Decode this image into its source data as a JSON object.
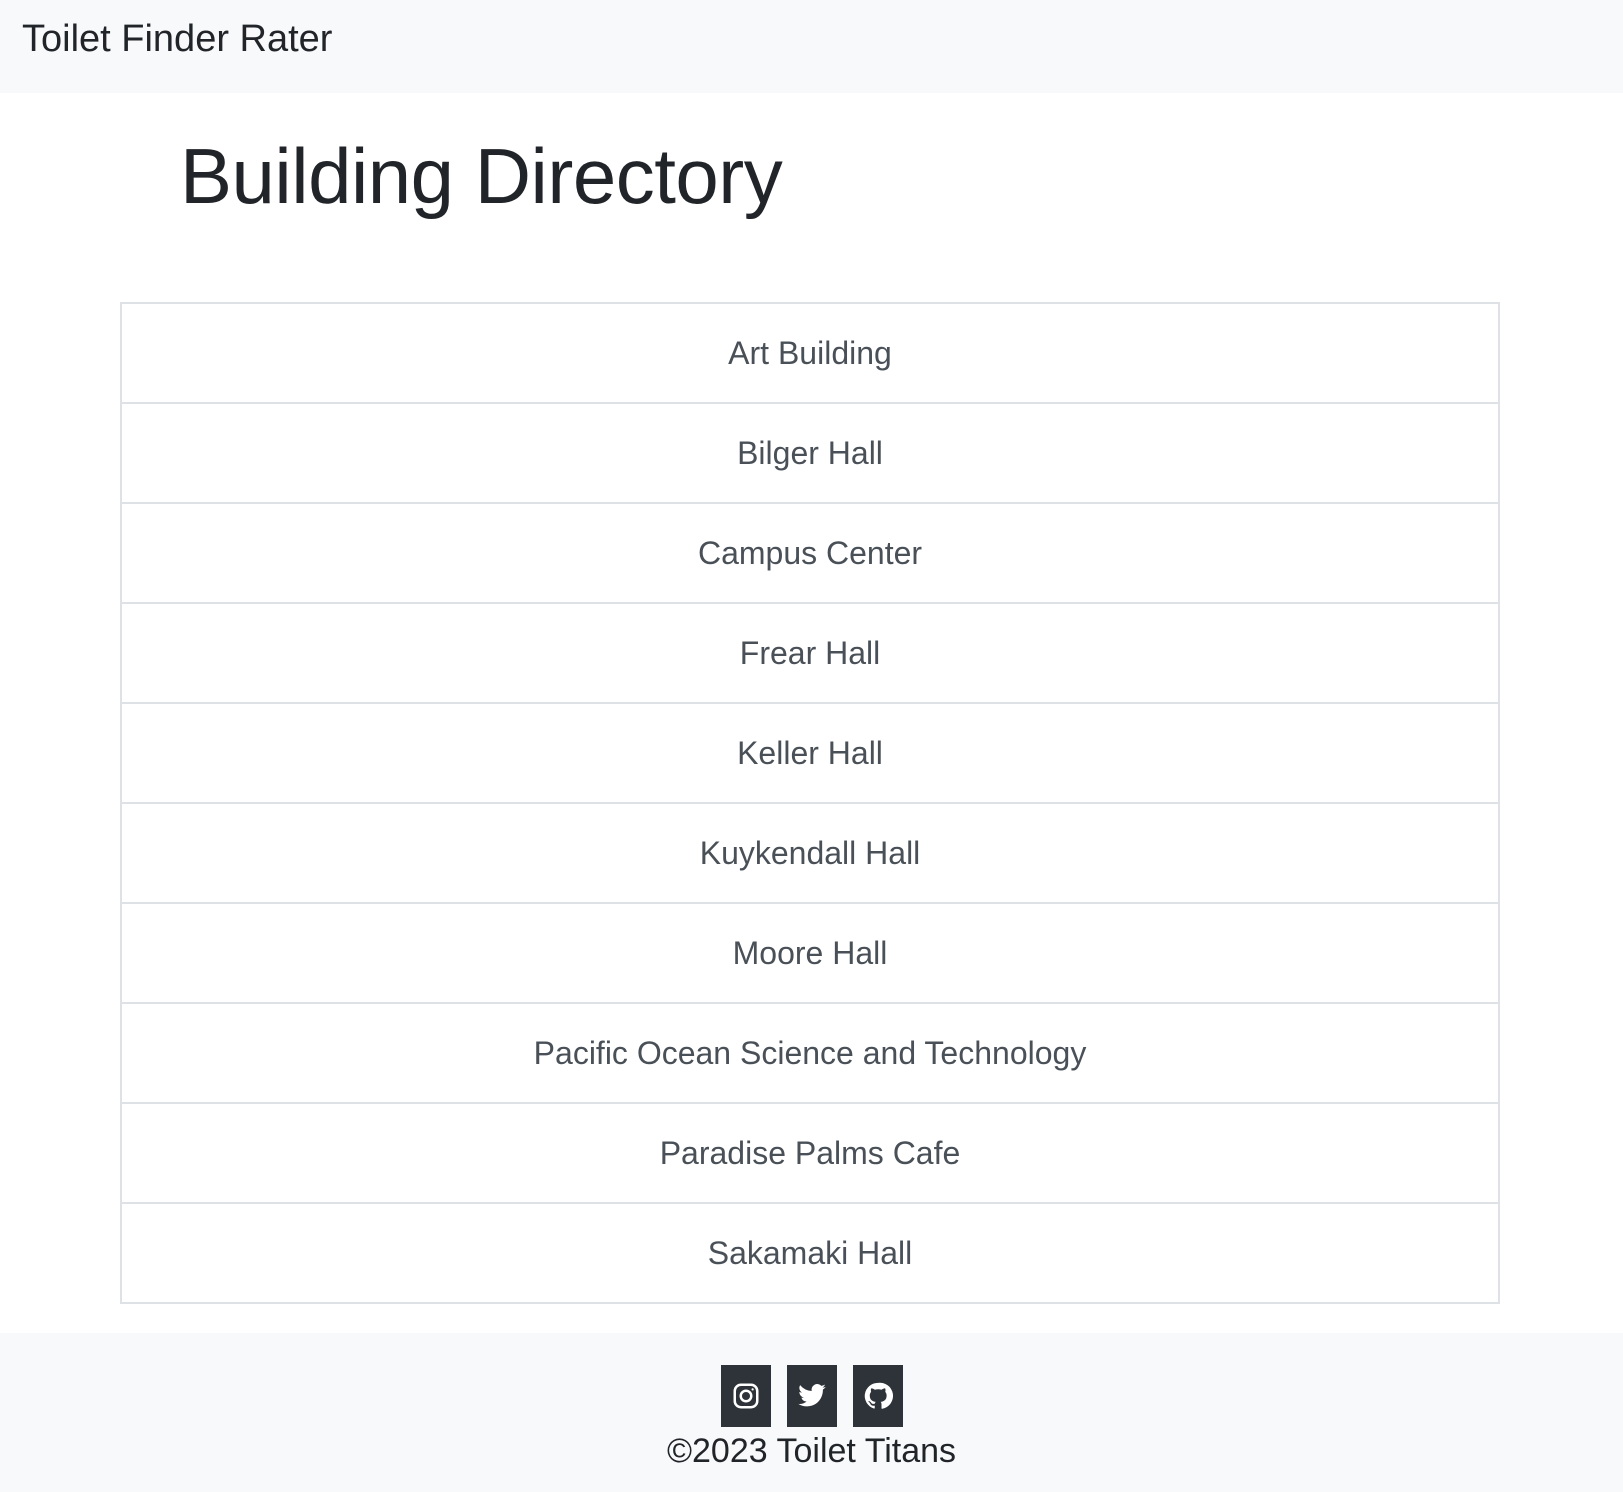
{
  "navbar": {
    "brand": "Toilet Finder Rater"
  },
  "main": {
    "title": "Building Directory",
    "buildings": [
      "Art Building",
      "Bilger Hall",
      "Campus Center",
      "Frear Hall",
      "Keller Hall",
      "Kuykendall Hall",
      "Moore Hall",
      "Pacific Ocean Science and Technology",
      "Paradise Palms Cafe",
      "Sakamaki Hall"
    ]
  },
  "footer": {
    "social_icons": [
      "instagram-icon",
      "twitter-icon",
      "github-icon"
    ],
    "copyright": "©2023 Toilet Titans"
  },
  "colors": {
    "navbar_bg": "#f8f9fa",
    "footer_bg": "#f8f9fa",
    "social_button_bg": "#2d3338",
    "list_border": "#dee2e6",
    "list_text": "#495057",
    "heading_text": "#212529"
  }
}
